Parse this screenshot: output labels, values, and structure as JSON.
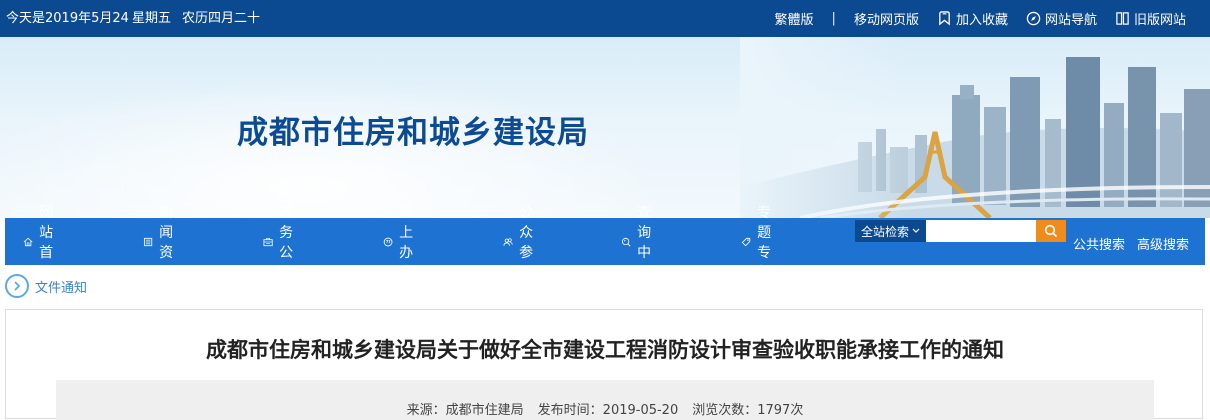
{
  "topbar": {
    "date": "今天是2019年5月24日",
    "weekday": "星期五",
    "lunar": "农历四月二十",
    "traditional": "繁體版",
    "divider": "|",
    "mobile": "移动网页版",
    "favorite": "加入收藏",
    "sitenav": "网站导航",
    "oldsite": "旧版网站"
  },
  "banner": {
    "title": "成都市住房和城乡建设局"
  },
  "nav": {
    "items": [
      {
        "label": "网站首页",
        "icon": "home-icon"
      },
      {
        "label": "新闻资讯",
        "icon": "news-icon"
      },
      {
        "label": "政务公开",
        "icon": "briefcase-icon"
      },
      {
        "label": "网上办事",
        "icon": "service-icon"
      },
      {
        "label": "公众参与",
        "icon": "people-icon"
      },
      {
        "label": "查询中心",
        "icon": "search-circle-icon"
      },
      {
        "label": "专题专栏",
        "icon": "tag-icon"
      }
    ],
    "search_scope": "全站检索",
    "search_placeholder": "",
    "public_search": "公共搜索",
    "advanced_search": "高级搜索"
  },
  "breadcrumb": {
    "label": "文件通知"
  },
  "article": {
    "title": "成都市住房和城乡建设局关于做好全市建设工程消防设计审查验收职能承接工作的通知",
    "source": "来源：成都市住建局",
    "published": "发布时间：2019-05-20",
    "views": "浏览次数：1797次"
  },
  "colors": {
    "topbar": "#0b4a91",
    "nav": "#1e73d2",
    "title": "#0c4b94",
    "search_button": "#f08c1c"
  }
}
